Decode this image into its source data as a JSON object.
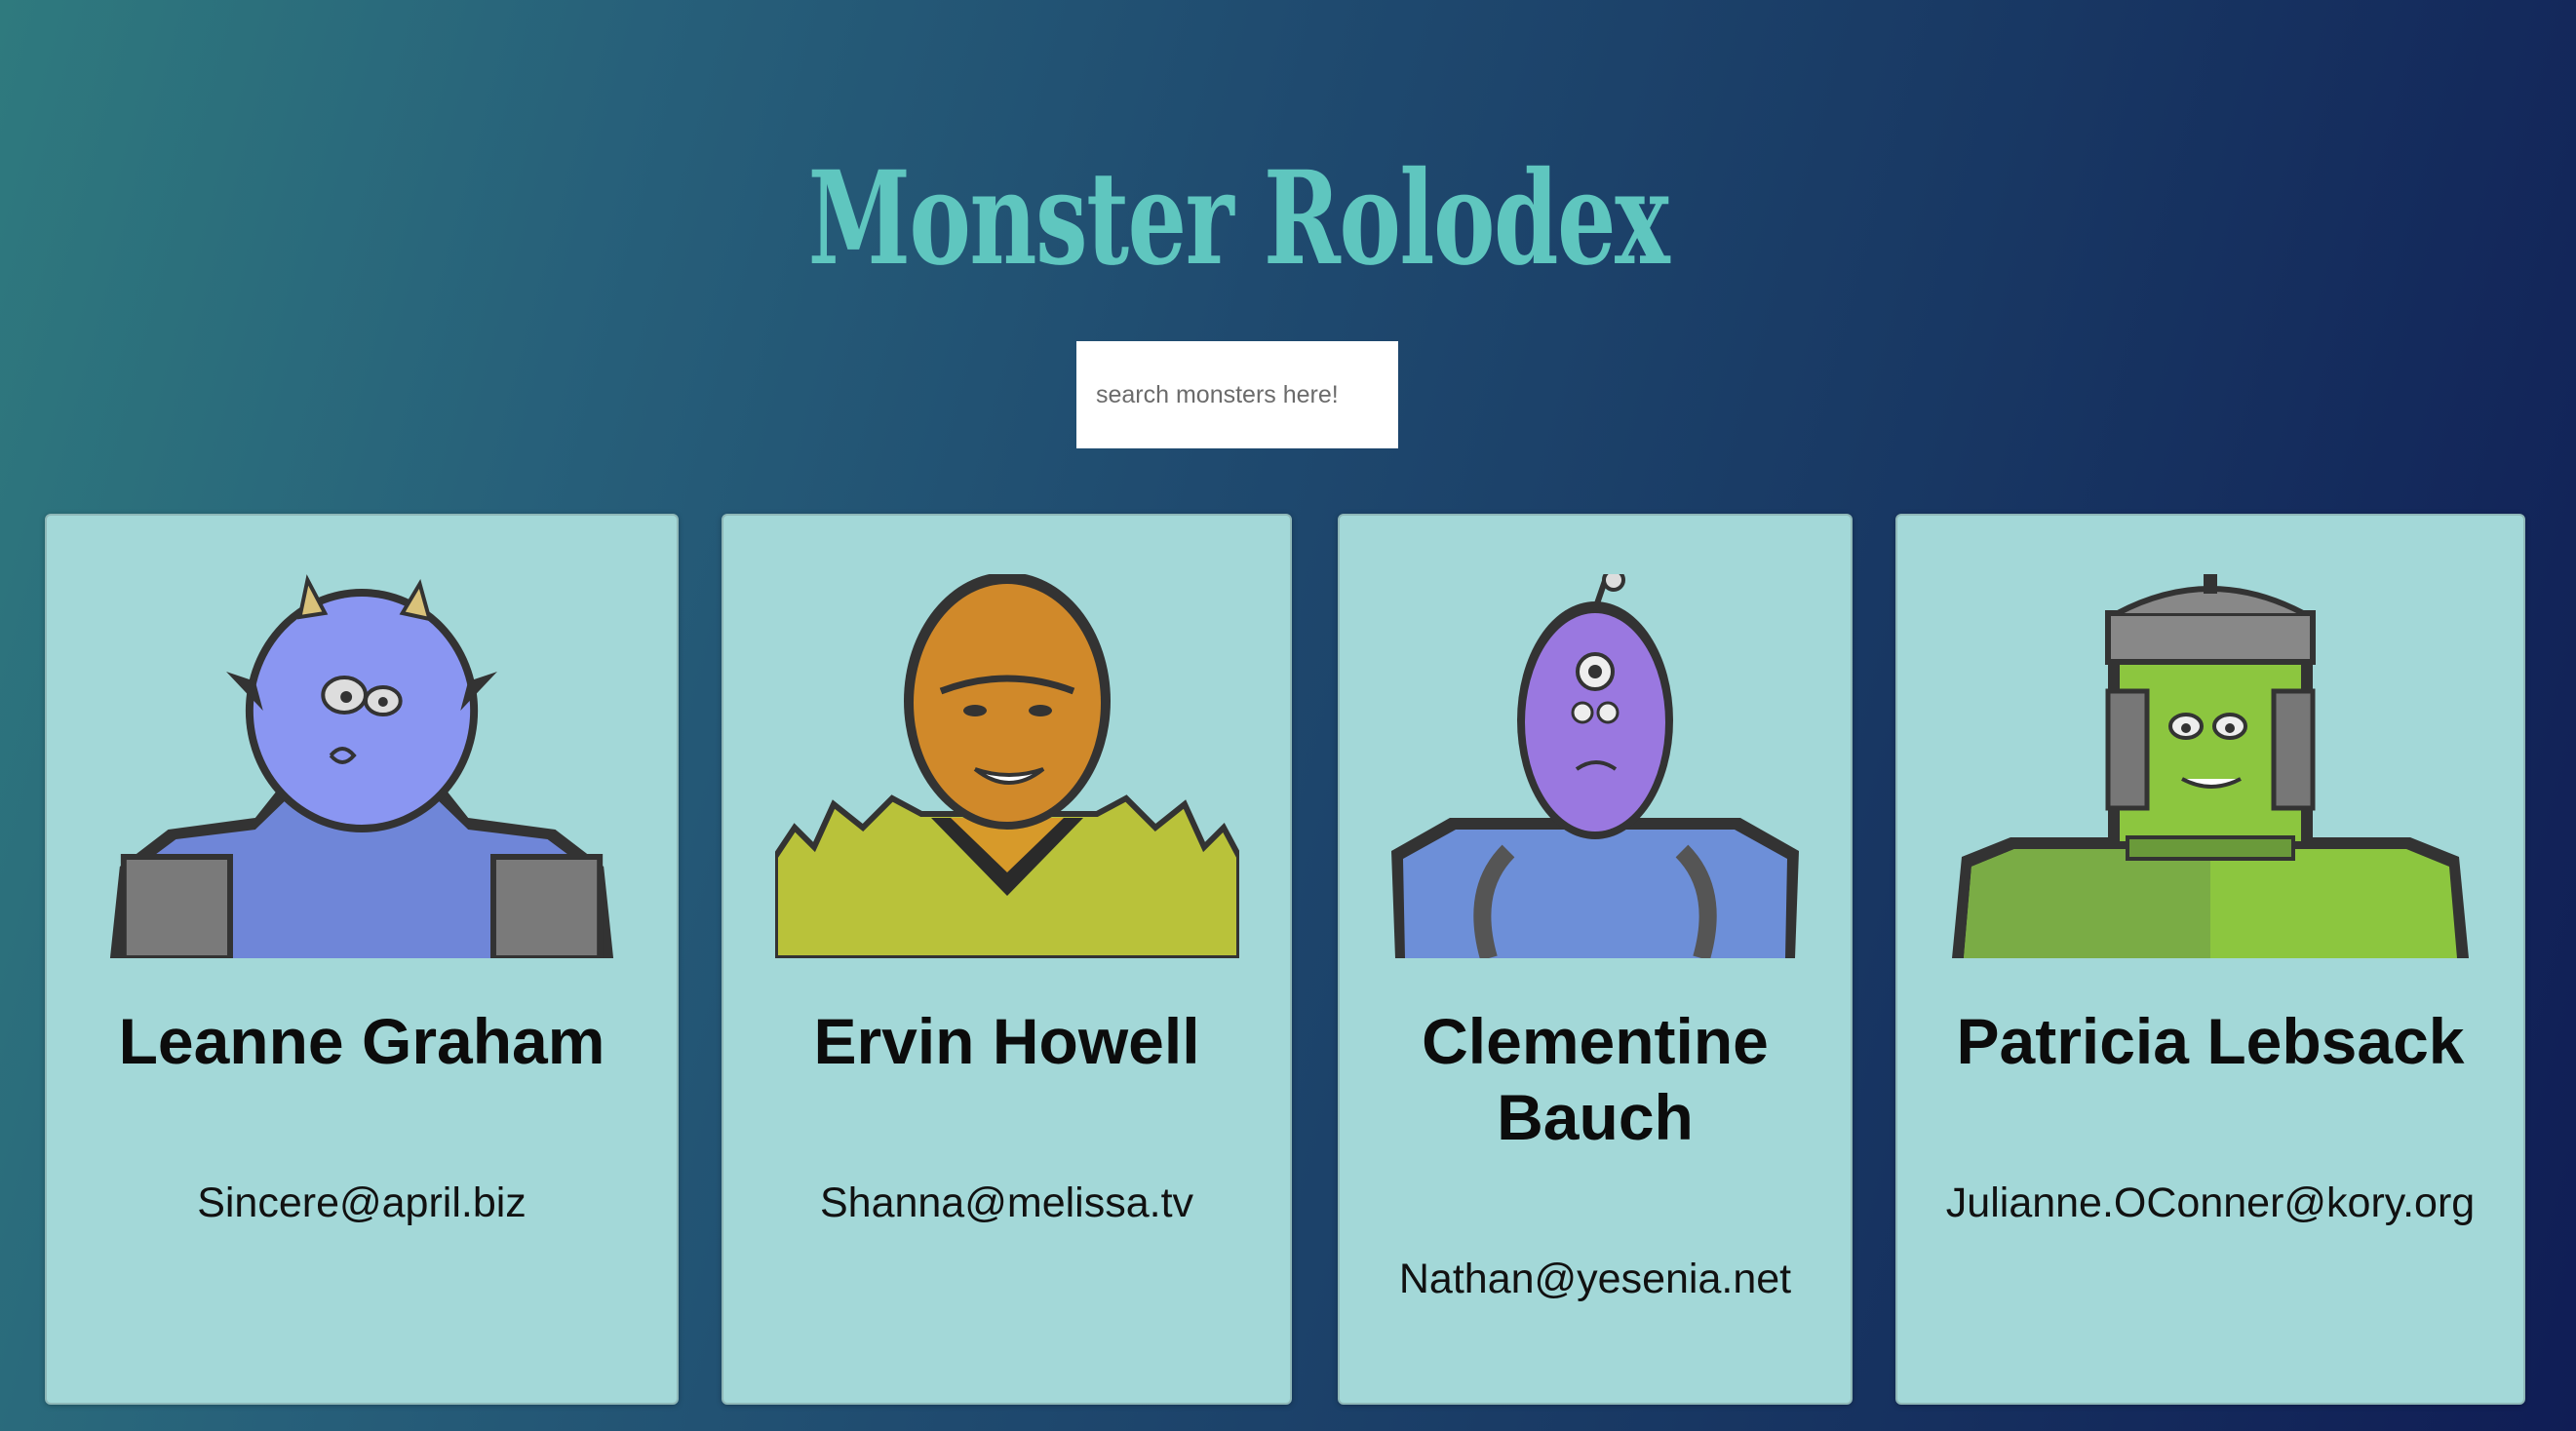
{
  "app": {
    "title": "Monster Rolodex"
  },
  "search": {
    "placeholder": "search monsters here!",
    "value": ""
  },
  "cards": [
    {
      "name": "Leanne Graham",
      "email": "Sincere@april.biz",
      "avatar_icon": "blue-horned-monster-icon"
    },
    {
      "name": "Ervin Howell",
      "email": "Shanna@melissa.tv",
      "avatar_icon": "orange-spiky-monster-icon"
    },
    {
      "name": "Clementine Bauch",
      "email": "Nathan@yesenia.net",
      "avatar_icon": "purple-cyclops-robot-monster-icon"
    },
    {
      "name": "Patricia Lebsack",
      "email": "Julianne.OConner@kory.org",
      "avatar_icon": "green-helmet-monster-icon"
    }
  ],
  "colors": {
    "title": "#5fc6bf",
    "card_bg": "#a3d8d8",
    "bg_start": "#2f7a7e",
    "bg_end": "#101d55"
  }
}
